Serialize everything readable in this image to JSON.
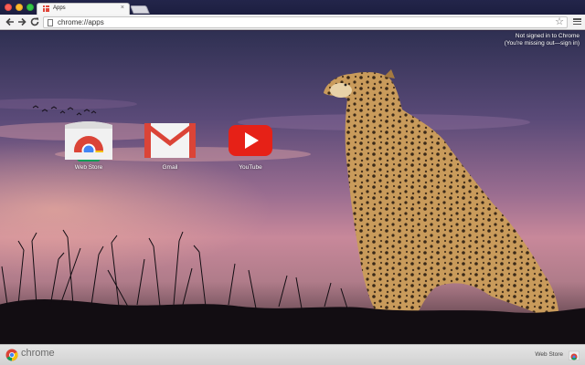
{
  "window": {
    "tab_title": "Apps",
    "tab_close": "×"
  },
  "toolbar": {
    "url": "chrome://apps"
  },
  "account": {
    "line1": "Not signed in to Chrome",
    "line2": "(You're missing out—sign in)"
  },
  "apps": [
    {
      "label": "Web Store",
      "icon": "chrome-web-store-icon"
    },
    {
      "label": "Gmail",
      "icon": "gmail-icon"
    },
    {
      "label": "YouTube",
      "icon": "youtube-icon"
    }
  ],
  "bottom_bar": {
    "brand": "chrome",
    "webstore_link": "Web Store"
  },
  "colors": {
    "chrome_red": "#db4437",
    "chrome_yellow": "#f4c20d",
    "chrome_green": "#0f9d58",
    "chrome_blue": "#4285f4",
    "youtube_red": "#e62117"
  }
}
